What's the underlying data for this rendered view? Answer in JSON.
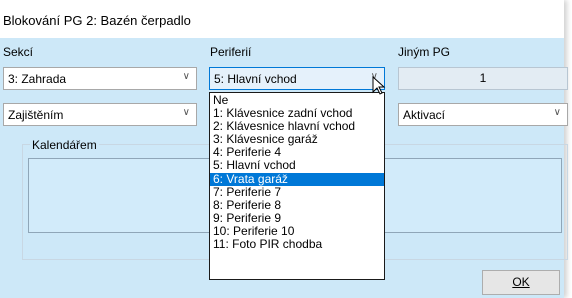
{
  "window": {
    "title": "Blokování PG 2: Bazén čerpadlo"
  },
  "labels": {
    "sekci": "Sekcí",
    "periferii": "Periferií",
    "jinym_pg": "Jiným PG",
    "kalendarem": "Kalendářem"
  },
  "combos": {
    "sekce_value": "3: Zahrada",
    "periferie_value": "5: Hlavní vchod",
    "zajisteni_value": "Zajištěním",
    "aktivaci_value": "Aktivací"
  },
  "jiny_pg_value": "1",
  "dropdown": {
    "selected_index": 6,
    "options": [
      "Ne",
      "1: Klávesnice zadní vchod",
      "2: Klávesnice hlavní vchod",
      "3: Klávesnice garáž",
      "4: Periferie 4",
      "5: Hlavní vchod",
      "6: Vrata garáž",
      "7: Periferie 7",
      "8: Periferie 8",
      "9: Periferie 9",
      "10: Periferie 10",
      "11: Foto PIR chodba"
    ]
  },
  "buttons": {
    "ok": "OK"
  },
  "colors": {
    "client_bg": "#cde8f8",
    "selection": "#0078d7"
  },
  "icons": {
    "combo_arrow": "chevron-down-icon",
    "cursor": "mouse-pointer-icon"
  }
}
